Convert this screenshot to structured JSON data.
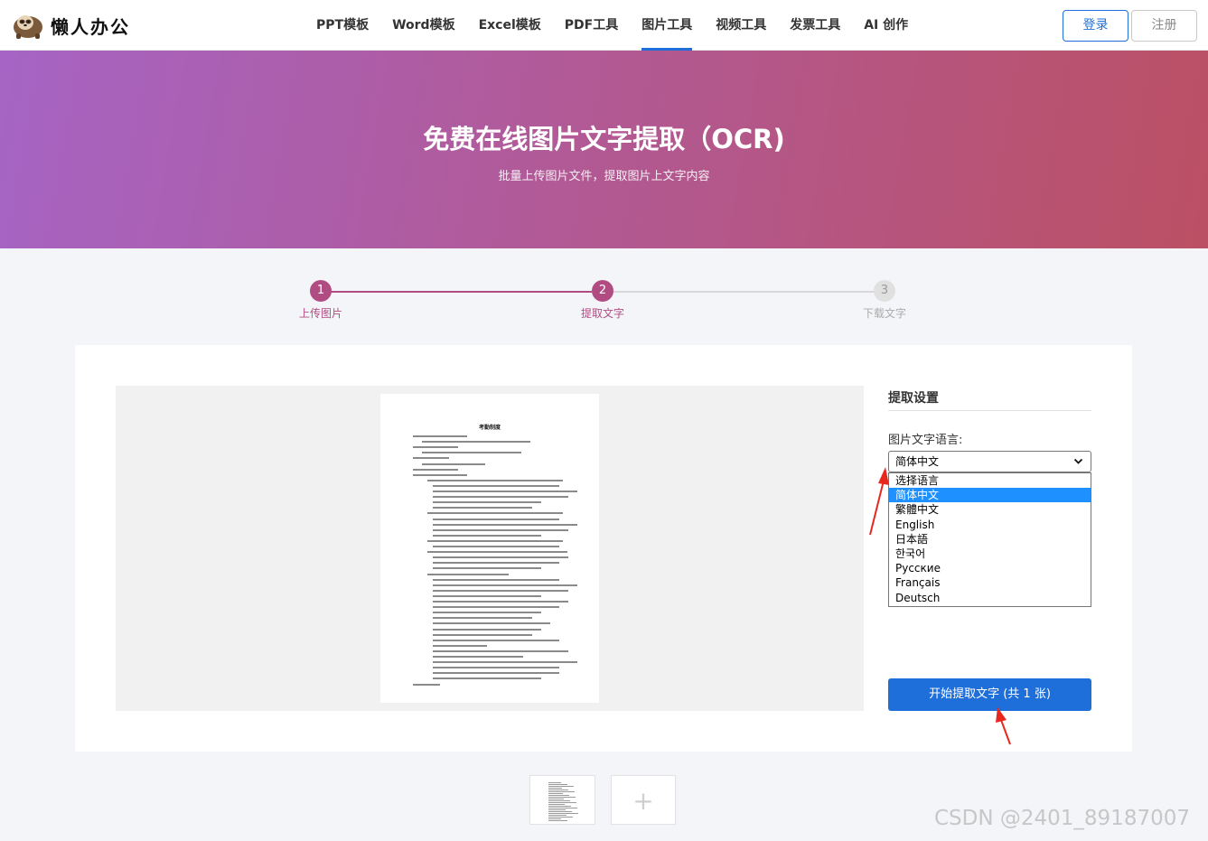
{
  "header": {
    "logo_text": "懒人办公",
    "nav": [
      {
        "label": "PPT模板"
      },
      {
        "label": "Word模板"
      },
      {
        "label": "Excel模板"
      },
      {
        "label": "PDF工具"
      },
      {
        "label": "图片工具",
        "active": true
      },
      {
        "label": "视频工具"
      },
      {
        "label": "发票工具"
      },
      {
        "label": "AI 创作"
      }
    ],
    "login_label": "登录",
    "register_label": "注册"
  },
  "banner": {
    "title": "免费在线图片文字提取（OCR)",
    "subtitle": "批量上传图片文件，提取图片上文字内容"
  },
  "steps": [
    {
      "num": "1",
      "label": "上传图片",
      "state": "done"
    },
    {
      "num": "2",
      "label": "提取文字",
      "state": "done"
    },
    {
      "num": "3",
      "label": "下载文字",
      "state": "todo"
    }
  ],
  "preview": {
    "doc_title": "考勤制度"
  },
  "settings": {
    "title": "提取设置",
    "language_label": "图片文字语言:",
    "selected_language": "简体中文",
    "options": [
      "选择语言",
      "简体中文",
      "繁體中文",
      "English",
      "日本語",
      "한국어",
      "Русские",
      "Français",
      "Deutsch"
    ],
    "start_button": "开始提取文字 (共 1 张)"
  },
  "add_thumb_label": "+",
  "watermark": "CSDN @2401_89187007",
  "colors": {
    "accent": "#1e6fd9",
    "step_done": "#b14c83",
    "banner_start": "#a664c4",
    "banner_end": "#bb5064",
    "arrow": "#e8281f"
  }
}
